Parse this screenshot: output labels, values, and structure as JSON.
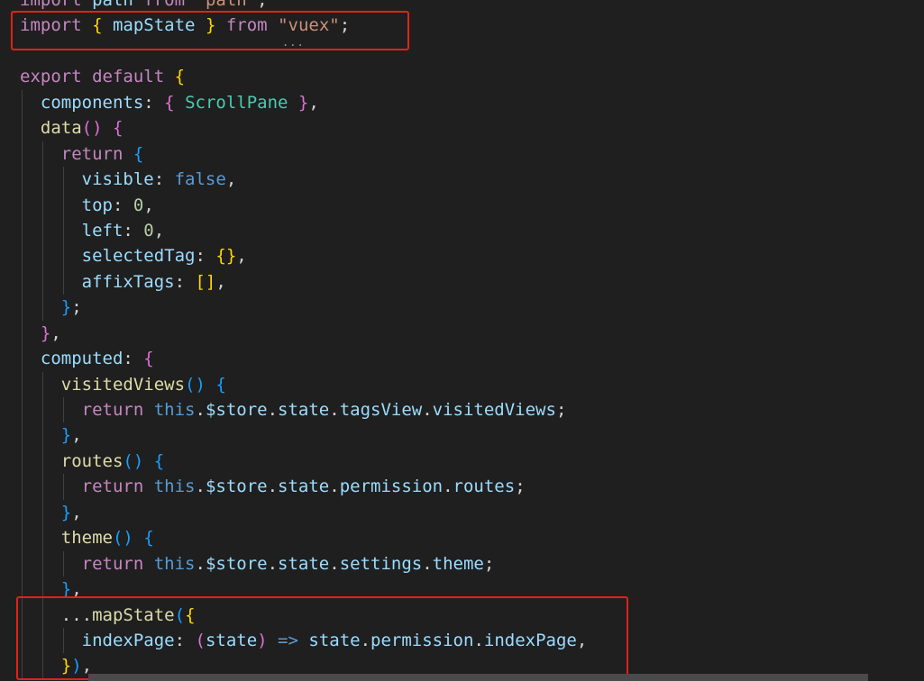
{
  "editor": {
    "lines": [
      [
        {
          "t": "import",
          "c": "kw"
        },
        {
          "t": " path ",
          "c": "prop"
        },
        {
          "t": "from",
          "c": "kw"
        },
        {
          "t": " ",
          "c": "punc"
        },
        {
          "t": "\"path\"",
          "c": "str"
        },
        {
          "t": ";",
          "c": "punc"
        }
      ],
      [
        {
          "t": "import",
          "c": "kw"
        },
        {
          "t": " ",
          "c": "punc"
        },
        {
          "t": "{",
          "c": "p1"
        },
        {
          "t": " mapState ",
          "c": "prop"
        },
        {
          "t": "}",
          "c": "p1"
        },
        {
          "t": " ",
          "c": "punc"
        },
        {
          "t": "from",
          "c": "kw"
        },
        {
          "t": " ",
          "c": "punc"
        },
        {
          "t": "\"vuex\"",
          "c": "str"
        },
        {
          "t": ";",
          "c": "punc"
        }
      ],
      [],
      [
        {
          "t": "export",
          "c": "kw"
        },
        {
          "t": " ",
          "c": "punc"
        },
        {
          "t": "default",
          "c": "kw"
        },
        {
          "t": " ",
          "c": "punc"
        },
        {
          "t": "{",
          "c": "p1"
        }
      ],
      [
        {
          "t": "  ",
          "c": "punc"
        },
        {
          "t": "components",
          "c": "prop"
        },
        {
          "t": ": ",
          "c": "punc"
        },
        {
          "t": "{",
          "c": "p2"
        },
        {
          "t": " ",
          "c": "punc"
        },
        {
          "t": "ScrollPane",
          "c": "cls"
        },
        {
          "t": " ",
          "c": "punc"
        },
        {
          "t": "}",
          "c": "p2"
        },
        {
          "t": ",",
          "c": "punc"
        }
      ],
      [
        {
          "t": "  ",
          "c": "punc"
        },
        {
          "t": "data",
          "c": "fn"
        },
        {
          "t": "()",
          "c": "p2"
        },
        {
          "t": " ",
          "c": "punc"
        },
        {
          "t": "{",
          "c": "p2"
        }
      ],
      [
        {
          "t": "    ",
          "c": "punc"
        },
        {
          "t": "return",
          "c": "kw"
        },
        {
          "t": " ",
          "c": "punc"
        },
        {
          "t": "{",
          "c": "p3"
        }
      ],
      [
        {
          "t": "      ",
          "c": "punc"
        },
        {
          "t": "visible",
          "c": "prop"
        },
        {
          "t": ": ",
          "c": "punc"
        },
        {
          "t": "false",
          "c": "kwb"
        },
        {
          "t": ",",
          "c": "punc"
        }
      ],
      [
        {
          "t": "      ",
          "c": "punc"
        },
        {
          "t": "top",
          "c": "prop"
        },
        {
          "t": ": ",
          "c": "punc"
        },
        {
          "t": "0",
          "c": "num"
        },
        {
          "t": ",",
          "c": "punc"
        }
      ],
      [
        {
          "t": "      ",
          "c": "punc"
        },
        {
          "t": "left",
          "c": "prop"
        },
        {
          "t": ": ",
          "c": "punc"
        },
        {
          "t": "0",
          "c": "num"
        },
        {
          "t": ",",
          "c": "punc"
        }
      ],
      [
        {
          "t": "      ",
          "c": "punc"
        },
        {
          "t": "selectedTag",
          "c": "prop"
        },
        {
          "t": ": ",
          "c": "punc"
        },
        {
          "t": "{}",
          "c": "p1"
        },
        {
          "t": ",",
          "c": "punc"
        }
      ],
      [
        {
          "t": "      ",
          "c": "punc"
        },
        {
          "t": "affixTags",
          "c": "prop"
        },
        {
          "t": ": ",
          "c": "punc"
        },
        {
          "t": "[]",
          "c": "p1"
        },
        {
          "t": ",",
          "c": "punc"
        }
      ],
      [
        {
          "t": "    ",
          "c": "punc"
        },
        {
          "t": "}",
          "c": "p3"
        },
        {
          "t": ";",
          "c": "punc"
        }
      ],
      [
        {
          "t": "  ",
          "c": "punc"
        },
        {
          "t": "}",
          "c": "p2"
        },
        {
          "t": ",",
          "c": "punc"
        }
      ],
      [
        {
          "t": "  ",
          "c": "punc"
        },
        {
          "t": "computed",
          "c": "prop"
        },
        {
          "t": ": ",
          "c": "punc"
        },
        {
          "t": "{",
          "c": "p2"
        }
      ],
      [
        {
          "t": "    ",
          "c": "punc"
        },
        {
          "t": "visitedViews",
          "c": "fn"
        },
        {
          "t": "()",
          "c": "p3"
        },
        {
          "t": " ",
          "c": "punc"
        },
        {
          "t": "{",
          "c": "p3"
        }
      ],
      [
        {
          "t": "      ",
          "c": "punc"
        },
        {
          "t": "return",
          "c": "kw"
        },
        {
          "t": " ",
          "c": "punc"
        },
        {
          "t": "this",
          "c": "kwb"
        },
        {
          "t": ".",
          "c": "punc"
        },
        {
          "t": "$store",
          "c": "prop"
        },
        {
          "t": ".",
          "c": "punc"
        },
        {
          "t": "state",
          "c": "prop"
        },
        {
          "t": ".",
          "c": "punc"
        },
        {
          "t": "tagsView",
          "c": "prop"
        },
        {
          "t": ".",
          "c": "punc"
        },
        {
          "t": "visitedViews",
          "c": "prop"
        },
        {
          "t": ";",
          "c": "punc"
        }
      ],
      [
        {
          "t": "    ",
          "c": "punc"
        },
        {
          "t": "}",
          "c": "p3"
        },
        {
          "t": ",",
          "c": "punc"
        }
      ],
      [
        {
          "t": "    ",
          "c": "punc"
        },
        {
          "t": "routes",
          "c": "fn"
        },
        {
          "t": "()",
          "c": "p3"
        },
        {
          "t": " ",
          "c": "punc"
        },
        {
          "t": "{",
          "c": "p3"
        }
      ],
      [
        {
          "t": "      ",
          "c": "punc"
        },
        {
          "t": "return",
          "c": "kw"
        },
        {
          "t": " ",
          "c": "punc"
        },
        {
          "t": "this",
          "c": "kwb"
        },
        {
          "t": ".",
          "c": "punc"
        },
        {
          "t": "$store",
          "c": "prop"
        },
        {
          "t": ".",
          "c": "punc"
        },
        {
          "t": "state",
          "c": "prop"
        },
        {
          "t": ".",
          "c": "punc"
        },
        {
          "t": "permission",
          "c": "prop"
        },
        {
          "t": ".",
          "c": "punc"
        },
        {
          "t": "routes",
          "c": "prop"
        },
        {
          "t": ";",
          "c": "punc"
        }
      ],
      [
        {
          "t": "    ",
          "c": "punc"
        },
        {
          "t": "}",
          "c": "p3"
        },
        {
          "t": ",",
          "c": "punc"
        }
      ],
      [
        {
          "t": "    ",
          "c": "punc"
        },
        {
          "t": "theme",
          "c": "fn"
        },
        {
          "t": "()",
          "c": "p3"
        },
        {
          "t": " ",
          "c": "punc"
        },
        {
          "t": "{",
          "c": "p3"
        }
      ],
      [
        {
          "t": "      ",
          "c": "punc"
        },
        {
          "t": "return",
          "c": "kw"
        },
        {
          "t": " ",
          "c": "punc"
        },
        {
          "t": "this",
          "c": "kwb"
        },
        {
          "t": ".",
          "c": "punc"
        },
        {
          "t": "$store",
          "c": "prop"
        },
        {
          "t": ".",
          "c": "punc"
        },
        {
          "t": "state",
          "c": "prop"
        },
        {
          "t": ".",
          "c": "punc"
        },
        {
          "t": "settings",
          "c": "prop"
        },
        {
          "t": ".",
          "c": "punc"
        },
        {
          "t": "theme",
          "c": "prop"
        },
        {
          "t": ";",
          "c": "punc"
        }
      ],
      [
        {
          "t": "    ",
          "c": "punc"
        },
        {
          "t": "}",
          "c": "p3"
        },
        {
          "t": ",",
          "c": "punc"
        }
      ],
      [
        {
          "t": "    ",
          "c": "punc"
        },
        {
          "t": "...",
          "c": "punc"
        },
        {
          "t": "mapState",
          "c": "fn"
        },
        {
          "t": "(",
          "c": "p3"
        },
        {
          "t": "{",
          "c": "p1"
        }
      ],
      [
        {
          "t": "      ",
          "c": "punc"
        },
        {
          "t": "indexPage",
          "c": "prop"
        },
        {
          "t": ": ",
          "c": "punc"
        },
        {
          "t": "(",
          "c": "p2"
        },
        {
          "t": "state",
          "c": "prop"
        },
        {
          "t": ")",
          "c": "p2"
        },
        {
          "t": " ",
          "c": "punc"
        },
        {
          "t": "=>",
          "c": "kwb"
        },
        {
          "t": " ",
          "c": "punc"
        },
        {
          "t": "state",
          "c": "prop"
        },
        {
          "t": ".",
          "c": "punc"
        },
        {
          "t": "permission",
          "c": "prop"
        },
        {
          "t": ".",
          "c": "punc"
        },
        {
          "t": "indexPage",
          "c": "prop"
        },
        {
          "t": ",",
          "c": "punc"
        }
      ],
      [
        {
          "t": "    ",
          "c": "punc"
        },
        {
          "t": "}",
          "c": "p1"
        },
        {
          "t": ")",
          "c": "p3"
        },
        {
          "t": ",",
          "c": "punc"
        }
      ]
    ],
    "ellipsis_hint": "...",
    "colors": {
      "background": "#1f1f1f",
      "highlight_box": "#e0221b",
      "keyword": "#c586c0",
      "property": "#9cdcfe",
      "function": "#dcdcaa",
      "string": "#ce9178",
      "number": "#b5cea8"
    }
  }
}
